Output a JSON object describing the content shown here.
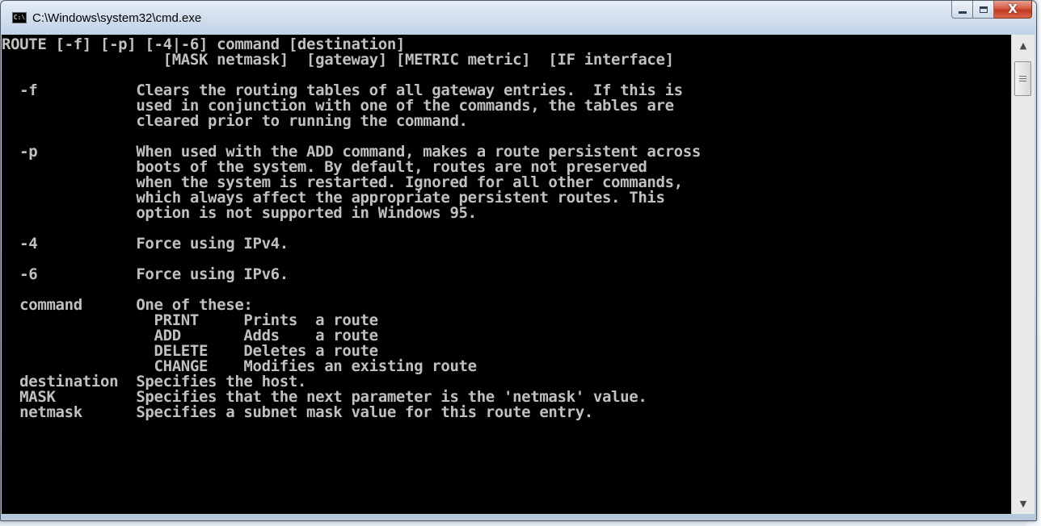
{
  "window": {
    "title": "C:\\Windows\\system32\\cmd.exe",
    "icon_label": "C:\\",
    "buttons": {
      "minimize_icon": "minimize-icon",
      "maximize_icon": "maximize-icon",
      "close_icon": "close-icon",
      "close_glyph": "X"
    }
  },
  "console": {
    "background": "#000000",
    "foreground": "#c0c0c0",
    "lines": [
      "ROUTE [-f] [-p] [-4|-6] command [destination]",
      "                  [MASK netmask]  [gateway] [METRIC metric]  [IF interface]",
      "",
      "  -f           Clears the routing tables of all gateway entries.  If this is",
      "               used in conjunction with one of the commands, the tables are",
      "               cleared prior to running the command.",
      "",
      "  -p           When used with the ADD command, makes a route persistent across",
      "               boots of the system. By default, routes are not preserved",
      "               when the system is restarted. Ignored for all other commands,",
      "               which always affect the appropriate persistent routes. This",
      "               option is not supported in Windows 95.",
      "",
      "  -4           Force using IPv4.",
      "",
      "  -6           Force using IPv6.",
      "",
      "  command      One of these:",
      "                 PRINT     Prints  a route",
      "                 ADD       Adds    a route",
      "                 DELETE    Deletes a route",
      "                 CHANGE    Modifies an existing route",
      "  destination  Specifies the host.",
      "  MASK         Specifies that the next parameter is the 'netmask' value.",
      "  netmask      Specifies a subnet mask value for this route entry."
    ]
  },
  "scrollbar": {
    "up_glyph": "▲",
    "down_glyph": "▼"
  }
}
